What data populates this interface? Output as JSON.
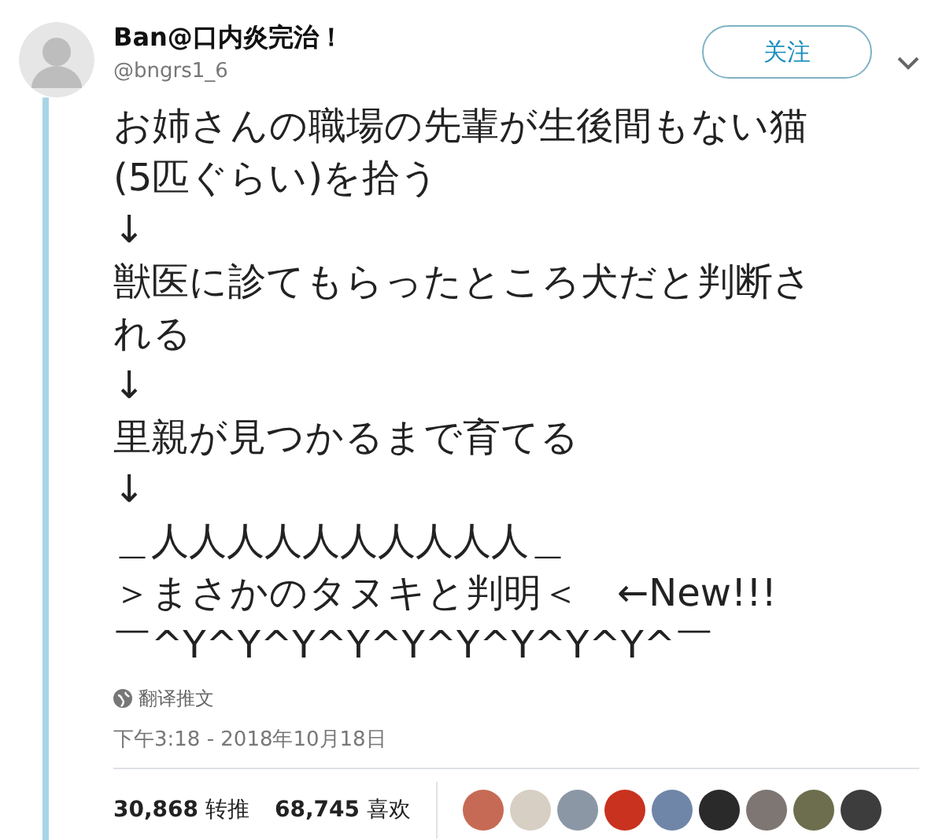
{
  "author": {
    "name": "Ban@口内炎完治！",
    "handle": "@bngrs1_6"
  },
  "follow_button": "关注",
  "body_lines": [
    "お姉さんの職場の先輩が生後間もない猫",
    "(5匹ぐらい)を拾う",
    "↓",
    "獣医に診てもらったところ犬だと判断さ",
    "れる",
    "↓",
    "里親が見つかるまで育てる",
    "↓",
    "＿人人人人人人人人人人＿",
    "＞まさかのタヌキと判明＜　←New!!!",
    "￣^Y^Y^Y^Y^Y^Y^Y^Y^Y^￣"
  ],
  "translate": "翻译推文",
  "timestamp": "下午3:18 - 2018年10月18日",
  "stats": [
    "**30,868** 转推",
    "**68,745** 喜欢"
  ],
  "liked_by": [
    {
      "color": "#c76a55"
    },
    {
      "color": "#d8cfc4"
    },
    {
      "color": "#8c97a6"
    },
    {
      "color": "#c8321e"
    },
    {
      "color": "#6f86a8"
    },
    {
      "color": "#2a2a2a"
    },
    {
      "color": "#7d7672"
    },
    {
      "color": "#6c6e4e"
    },
    {
      "color": "#3d3d3d"
    }
  ]
}
